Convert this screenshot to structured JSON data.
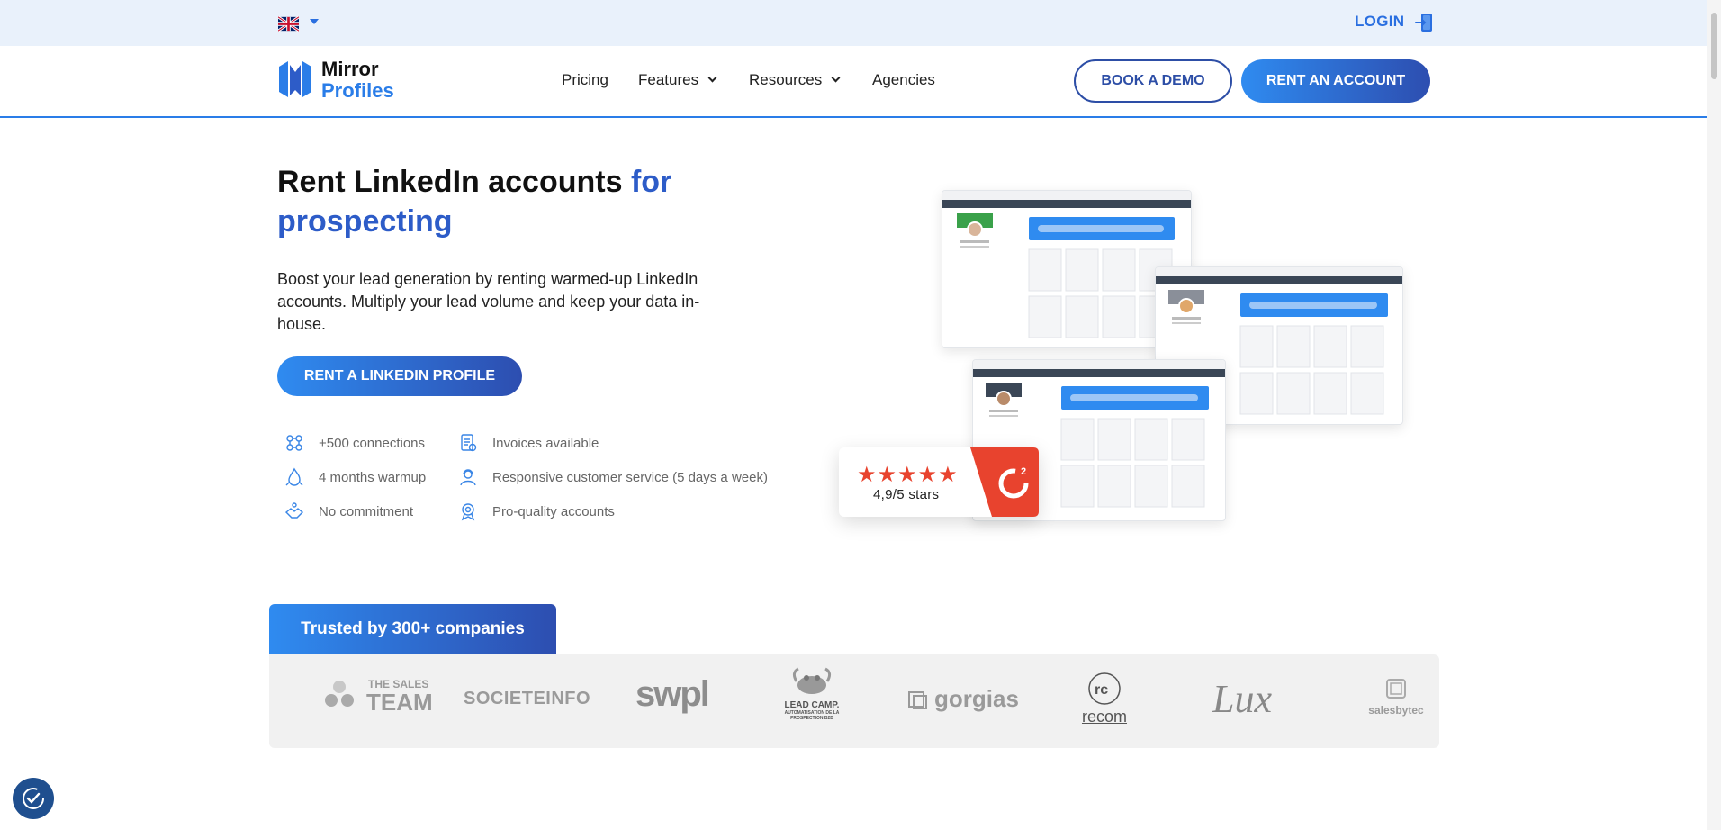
{
  "topbar": {
    "login_label": "LOGIN",
    "language": "English (UK)"
  },
  "brand": {
    "line1": "Mirror",
    "line2": "Profiles",
    "accent_color": "#2a7de8"
  },
  "nav": {
    "items": [
      {
        "label": "Pricing",
        "has_dropdown": false
      },
      {
        "label": "Features",
        "has_dropdown": true
      },
      {
        "label": "Resources",
        "has_dropdown": true
      },
      {
        "label": "Agencies",
        "has_dropdown": false
      }
    ],
    "book_demo_label": "BOOK A DEMO",
    "rent_account_label": "RENT AN ACCOUNT"
  },
  "hero": {
    "title_main": "Rent LinkedIn accounts ",
    "title_accent": "for prospecting",
    "subtitle": "Boost your lead generation by renting warmed-up LinkedIn accounts. Multiply your lead volume and keep your data in-house.",
    "cta_label": "RENT A LINKEDIN PROFILE"
  },
  "features": [
    {
      "label": "+500 connections",
      "icon": "connections-icon"
    },
    {
      "label": "Invoices available",
      "icon": "invoice-icon"
    },
    {
      "label": "4 months warmup",
      "icon": "warmup-icon"
    },
    {
      "label": "Responsive customer service (5 days a week)",
      "icon": "support-icon"
    },
    {
      "label": "No commitment",
      "icon": "handshake-icon"
    },
    {
      "label": "Pro-quality accounts",
      "icon": "quality-icon"
    }
  ],
  "rating": {
    "stars": "★★★★★",
    "text": "4,9/5 stars",
    "badge": "G2",
    "stars_value": 4.9,
    "stars_max": 5
  },
  "trusted": {
    "title": "Trusted by 300+ companies",
    "logos": [
      {
        "small": "THE SALES",
        "big": "TEAM"
      },
      {
        "text": "SOCIETEINFO"
      },
      {
        "text": "swpl"
      },
      {
        "line1": "LEAD CAMP.",
        "line2": "AUTOMATISATION DE LA",
        "line3": "PROSPECTION B2B"
      },
      {
        "text": "gorgias"
      },
      {
        "text": "recom"
      },
      {
        "text": "Lux"
      },
      {
        "text": "salesbytec"
      }
    ]
  },
  "colors": {
    "primary_blue": "#2a7de8",
    "dark_blue": "#2d4eb0",
    "g2_red": "#e8432e",
    "topbar_bg": "#e9f1fb"
  }
}
